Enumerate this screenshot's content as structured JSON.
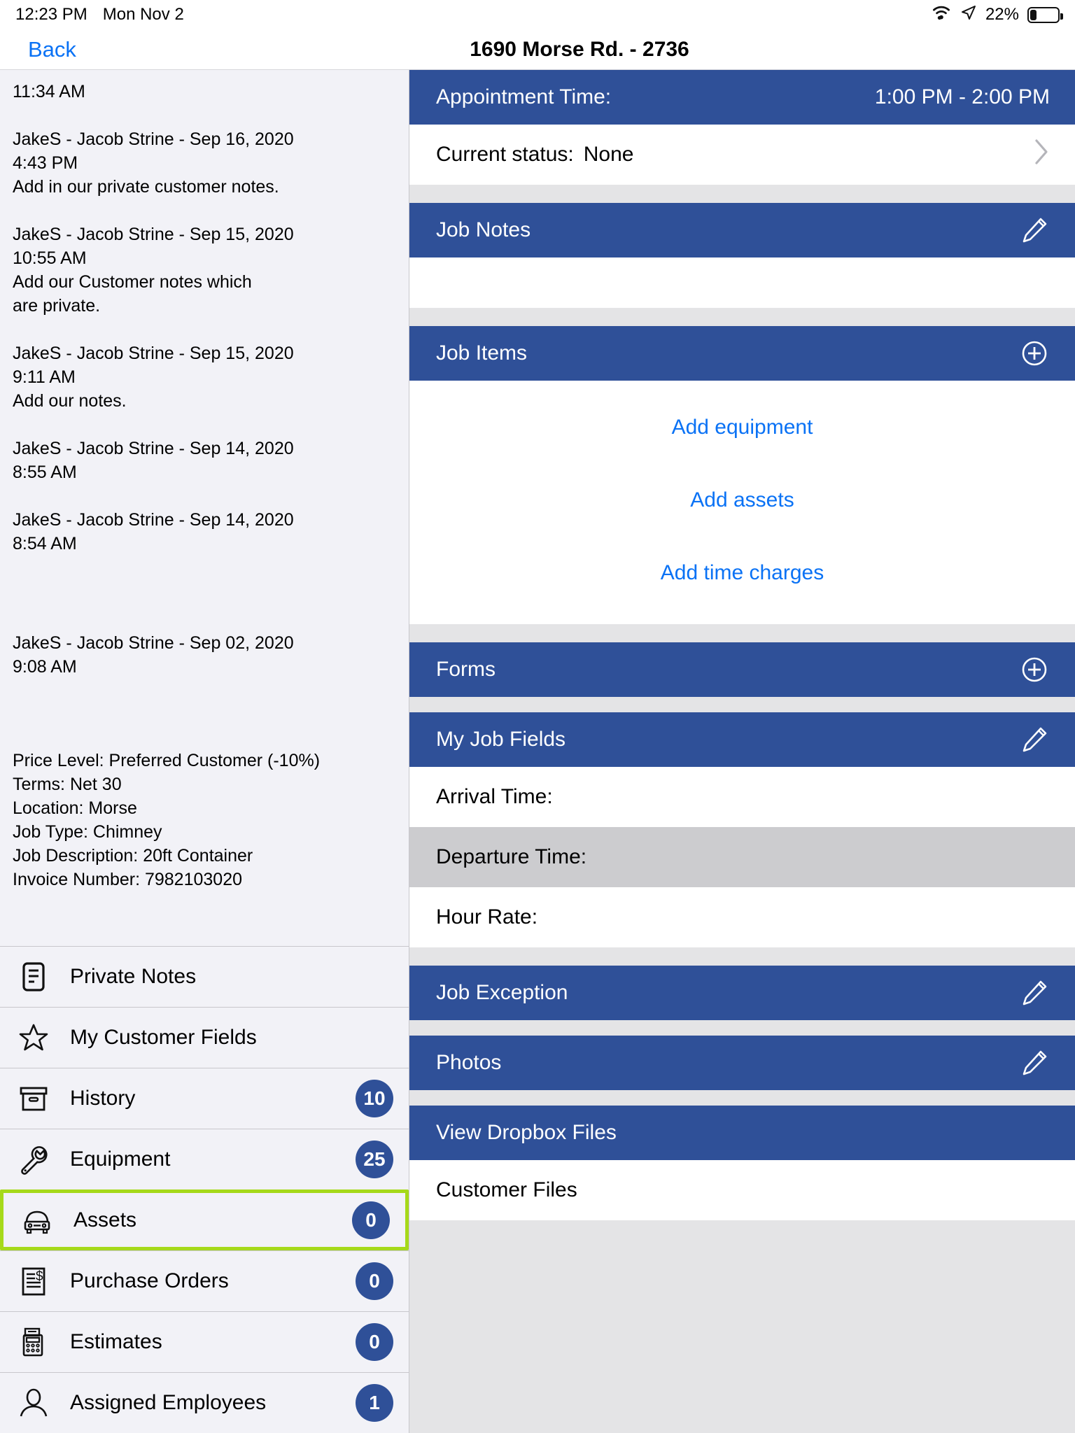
{
  "status_bar": {
    "time": "12:23 PM",
    "date": "Mon Nov 2",
    "battery_percent": "22%",
    "wifi_icon": "wifi-icon",
    "location_icon": "location-arrow-icon",
    "battery_icon": "battery-icon"
  },
  "nav": {
    "back_label": "Back",
    "title": "1690 Morse Rd. - 2736"
  },
  "sidebar": {
    "notes": [
      {
        "time_partial": "11:34 AM"
      },
      {
        "header": "JakeS - Jacob Strine - Sep 16, 2020",
        "time": "4:43 PM",
        "body": "Add in our private customer notes."
      },
      {
        "header": "JakeS - Jacob Strine - Sep 15, 2020",
        "time": "10:55 AM",
        "body": "Add our Customer notes which\nare private."
      },
      {
        "header": "JakeS - Jacob Strine - Sep 15, 2020",
        "time": "9:11 AM",
        "body": "Add our notes."
      },
      {
        "header": "JakeS - Jacob Strine - Sep 14, 2020",
        "time": "8:55 AM",
        "body": ""
      },
      {
        "header": "JakeS - Jacob Strine - Sep 14, 2020",
        "time": "8:54 AM",
        "body": ""
      },
      {
        "header": "JakeS - Jacob Strine - Sep 02, 2020",
        "time": "9:08 AM",
        "body": ""
      }
    ],
    "details": [
      "Price Level: Preferred Customer (-10%)",
      "Terms: Net 30",
      "Location: Morse",
      "Job Type: Chimney",
      "Job Description: 20ft Container",
      "Invoice Number: 7982103020"
    ],
    "menu_items": [
      {
        "label": "Private Notes",
        "icon": "document-notes-icon",
        "badge": null
      },
      {
        "label": "My Customer Fields",
        "icon": "star-icon",
        "badge": null
      },
      {
        "label": "History",
        "icon": "archive-box-icon",
        "badge": "10"
      },
      {
        "label": "Equipment",
        "icon": "wrench-icon",
        "badge": "25"
      },
      {
        "label": "Assets",
        "icon": "car-icon",
        "badge": "0",
        "highlighted": true
      },
      {
        "label": "Purchase Orders",
        "icon": "invoice-dollar-icon",
        "badge": "0"
      },
      {
        "label": "Estimates",
        "icon": "calculator-printer-icon",
        "badge": "0"
      },
      {
        "label": "Assigned Employees",
        "icon": "person-icon",
        "badge": "1"
      }
    ]
  },
  "main": {
    "appointment": {
      "label": "Appointment Time:",
      "value": "1:00 PM - 2:00 PM"
    },
    "current_status": {
      "label": "Current status:",
      "value": "None",
      "chevron_icon": "chevron-right-icon"
    },
    "job_notes": {
      "title": "Job Notes",
      "action_icon": "pencil-icon"
    },
    "job_items": {
      "title": "Job Items",
      "action_icon": "plus-circle-icon",
      "links": [
        "Add equipment",
        "Add assets",
        "Add time charges"
      ]
    },
    "forms": {
      "title": "Forms",
      "action_icon": "plus-circle-icon"
    },
    "my_job_fields": {
      "title": "My Job Fields",
      "action_icon": "pencil-icon",
      "rows": [
        {
          "label": "Arrival Time:",
          "shaded": false
        },
        {
          "label": "Departure Time:",
          "shaded": true
        },
        {
          "label": "Hour Rate:",
          "shaded": false
        }
      ]
    },
    "job_exception": {
      "title": "Job Exception",
      "action_icon": "pencil-icon"
    },
    "photos": {
      "title": "Photos",
      "action_icon": "pencil-icon"
    },
    "dropbox": {
      "title": "View Dropbox Files",
      "row_label": "Customer Files"
    }
  },
  "colors": {
    "header_blue": "#2f5098",
    "link_blue": "#0a72f5",
    "highlight_green": "#a6d91a",
    "sidebar_bg": "#f2f2f7",
    "panel_gap": "#e4e4e6",
    "shaded_row": "#cccccf"
  }
}
